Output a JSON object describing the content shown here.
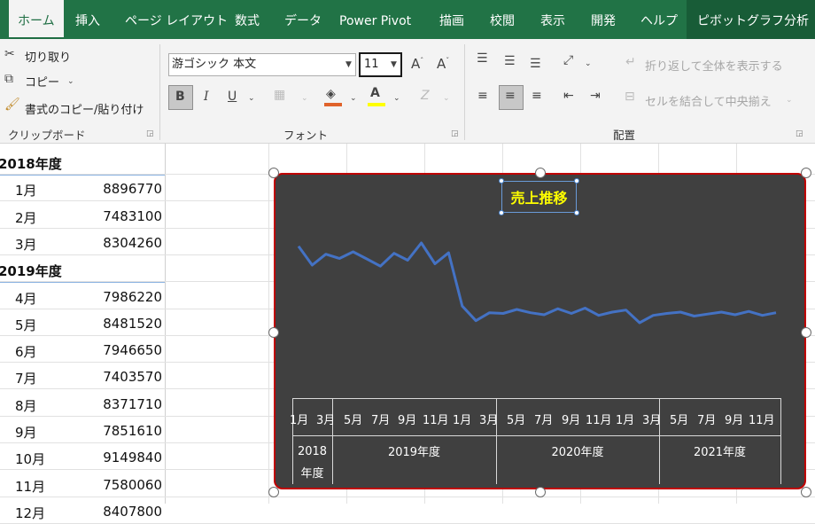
{
  "tabs": [
    "ホーム",
    "挿入",
    "ページ レイアウト",
    "数式",
    "データ",
    "Power Pivot",
    "描画",
    "校閲",
    "表示",
    "開発",
    "ヘルプ",
    "ピボットグラフ分析"
  ],
  "clipboard": {
    "cut": "切り取り",
    "copy": "コピー",
    "format_painter": "書式のコピー/貼り付け",
    "label": "クリップボード"
  },
  "font": {
    "name": "游ゴシック 本文",
    "size": "11",
    "label": "フォント"
  },
  "alignment": {
    "wrap": "折り返して全体を表示する",
    "merge": "セルを結合して中央揃え",
    "label": "配置"
  },
  "sheet_rows": [
    {
      "label": "2018年度",
      "value": ""
    },
    {
      "label": "1月",
      "value": "8896770"
    },
    {
      "label": "2月",
      "value": "7483100"
    },
    {
      "label": "3月",
      "value": "8304260"
    },
    {
      "label": "2019年度",
      "value": ""
    },
    {
      "label": "4月",
      "value": "7986220"
    },
    {
      "label": "5月",
      "value": "8481520"
    },
    {
      "label": "6月",
      "value": "7946650"
    },
    {
      "label": "7月",
      "value": "7403570"
    },
    {
      "label": "8月",
      "value": "8371710"
    },
    {
      "label": "9月",
      "value": "7851610"
    },
    {
      "label": "10月",
      "value": "9149840"
    },
    {
      "label": "11月",
      "value": "7580060"
    },
    {
      "label": "12月",
      "value": "8407800"
    }
  ],
  "chart_data": {
    "type": "line",
    "title": "売上推移",
    "color": "#4472c4",
    "values": [
      8896770,
      7483100,
      8304260,
      7986220,
      8481520,
      7946650,
      7403570,
      8371710,
      7851610,
      9149840,
      7580060,
      8407800,
      4400000,
      3300000,
      3900000,
      3850000,
      4150000,
      3900000,
      3750000,
      4200000,
      3850000,
      4250000,
      3700000,
      3950000,
      4100000,
      3150000,
      3700000,
      3850000,
      3950000,
      3650000,
      3800000,
      3950000,
      3750000,
      4000000,
      3700000,
      3900000
    ],
    "tick_labels": [
      "1月",
      "3月",
      "5月",
      "7月",
      "9月",
      "11月",
      "1月",
      "3月",
      "5月",
      "7月",
      "9月",
      "11月",
      "1月",
      "3月",
      "5月",
      "7月",
      "9月",
      "11月"
    ],
    "groups": [
      "2018年度",
      "2019年度",
      "2020年度",
      "2021年度"
    ]
  }
}
